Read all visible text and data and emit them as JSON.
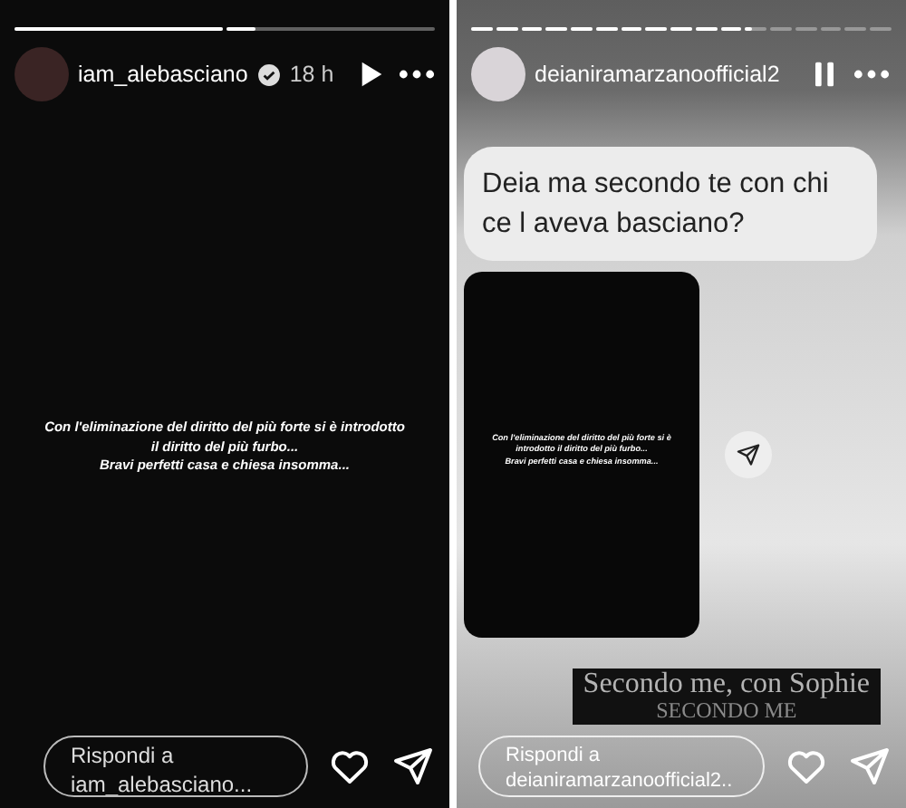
{
  "stories": [
    {
      "kind": "dark",
      "progress": [
        {
          "level": 1
        },
        {
          "level": 0.14
        }
      ],
      "username": "iam_alebasciano",
      "verified": true,
      "time": "18 h",
      "playing": false,
      "caption": "Con l'eliminazione del diritto del più forte si è introdotto il diritto del più furbo...\nBravi perfetti casa e chiesa insomma...",
      "reply_placeholder": "Rispondi a iam_alebasciano..."
    },
    {
      "kind": "light",
      "progress": [
        {
          "level": 1
        },
        {
          "level": 1
        },
        {
          "level": 1
        },
        {
          "level": 1
        },
        {
          "level": 1
        },
        {
          "level": 1
        },
        {
          "level": 1
        },
        {
          "level": 1
        },
        {
          "level": 1
        },
        {
          "level": 1
        },
        {
          "level": 1
        },
        {
          "level": 0.3
        },
        {
          "level": 0
        },
        {
          "level": 0
        },
        {
          "level": 0
        },
        {
          "level": 0
        },
        {
          "level": 0
        }
      ],
      "username": "deianiramarzanoofficial2",
      "verified": false,
      "playing": true,
      "question": "Deia ma secondo te con chi ce l aveva basciano?",
      "shared_story": {
        "caption": "Con l'eliminazione del diritto del più forte si è introdotto il diritto del più furbo...\nBravi perfetti casa e chiesa insomma..."
      },
      "sticker": [
        "Secondo me, con Sophie",
        "SECONDO ME"
      ],
      "reply_placeholder": "Rispondi a deianiramarzanoofficial2..."
    }
  ]
}
